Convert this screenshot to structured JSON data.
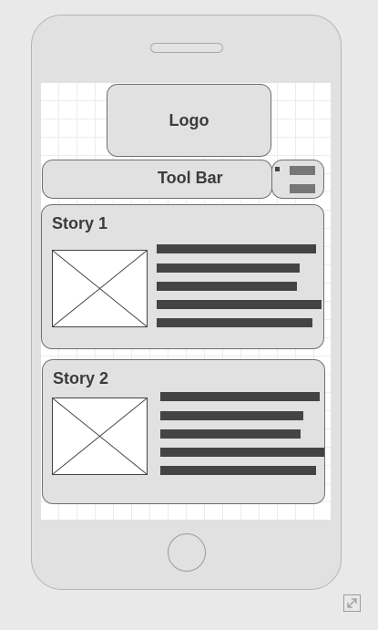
{
  "header": {
    "logo_label": "Logo"
  },
  "toolbar": {
    "label": "Tool Bar"
  },
  "stories": [
    {
      "title": "Story 1"
    },
    {
      "title": "Story 2"
    }
  ]
}
